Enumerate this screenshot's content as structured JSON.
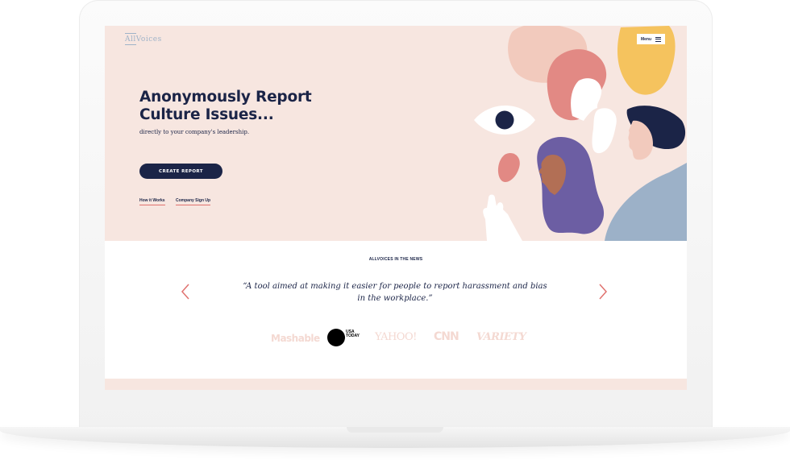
{
  "app": {
    "logo_text": "AllVoices"
  },
  "header": {
    "menu_label": "Menu"
  },
  "hero": {
    "headline": "Anonymously Report Culture Issues...",
    "subheadline": "directly to your company's leadership.",
    "cta_label": "CREATE REPORT",
    "links": [
      {
        "label": "How it Works"
      },
      {
        "label": "Company Sign Up"
      }
    ]
  },
  "news": {
    "section_title": "ALLVOICES IN THE NEWS",
    "quote": "“A tool aimed at making it easier for people to report harassment and bias in the workplace.”",
    "logos": [
      {
        "text": "Mashable"
      },
      {
        "text": "USA TODAY"
      },
      {
        "text": "YAHOO!"
      },
      {
        "text": "CNN"
      },
      {
        "text": "VARIETY"
      }
    ]
  },
  "colors": {
    "navy": "#1b2447",
    "hero_bg": "#f7e6e0",
    "accent_coral": "#e0726f",
    "logo_muted": "#f4d9d2"
  },
  "icons": {
    "menu": "hamburger-icon",
    "prev": "chevron-left-icon",
    "next": "chevron-right-icon"
  }
}
